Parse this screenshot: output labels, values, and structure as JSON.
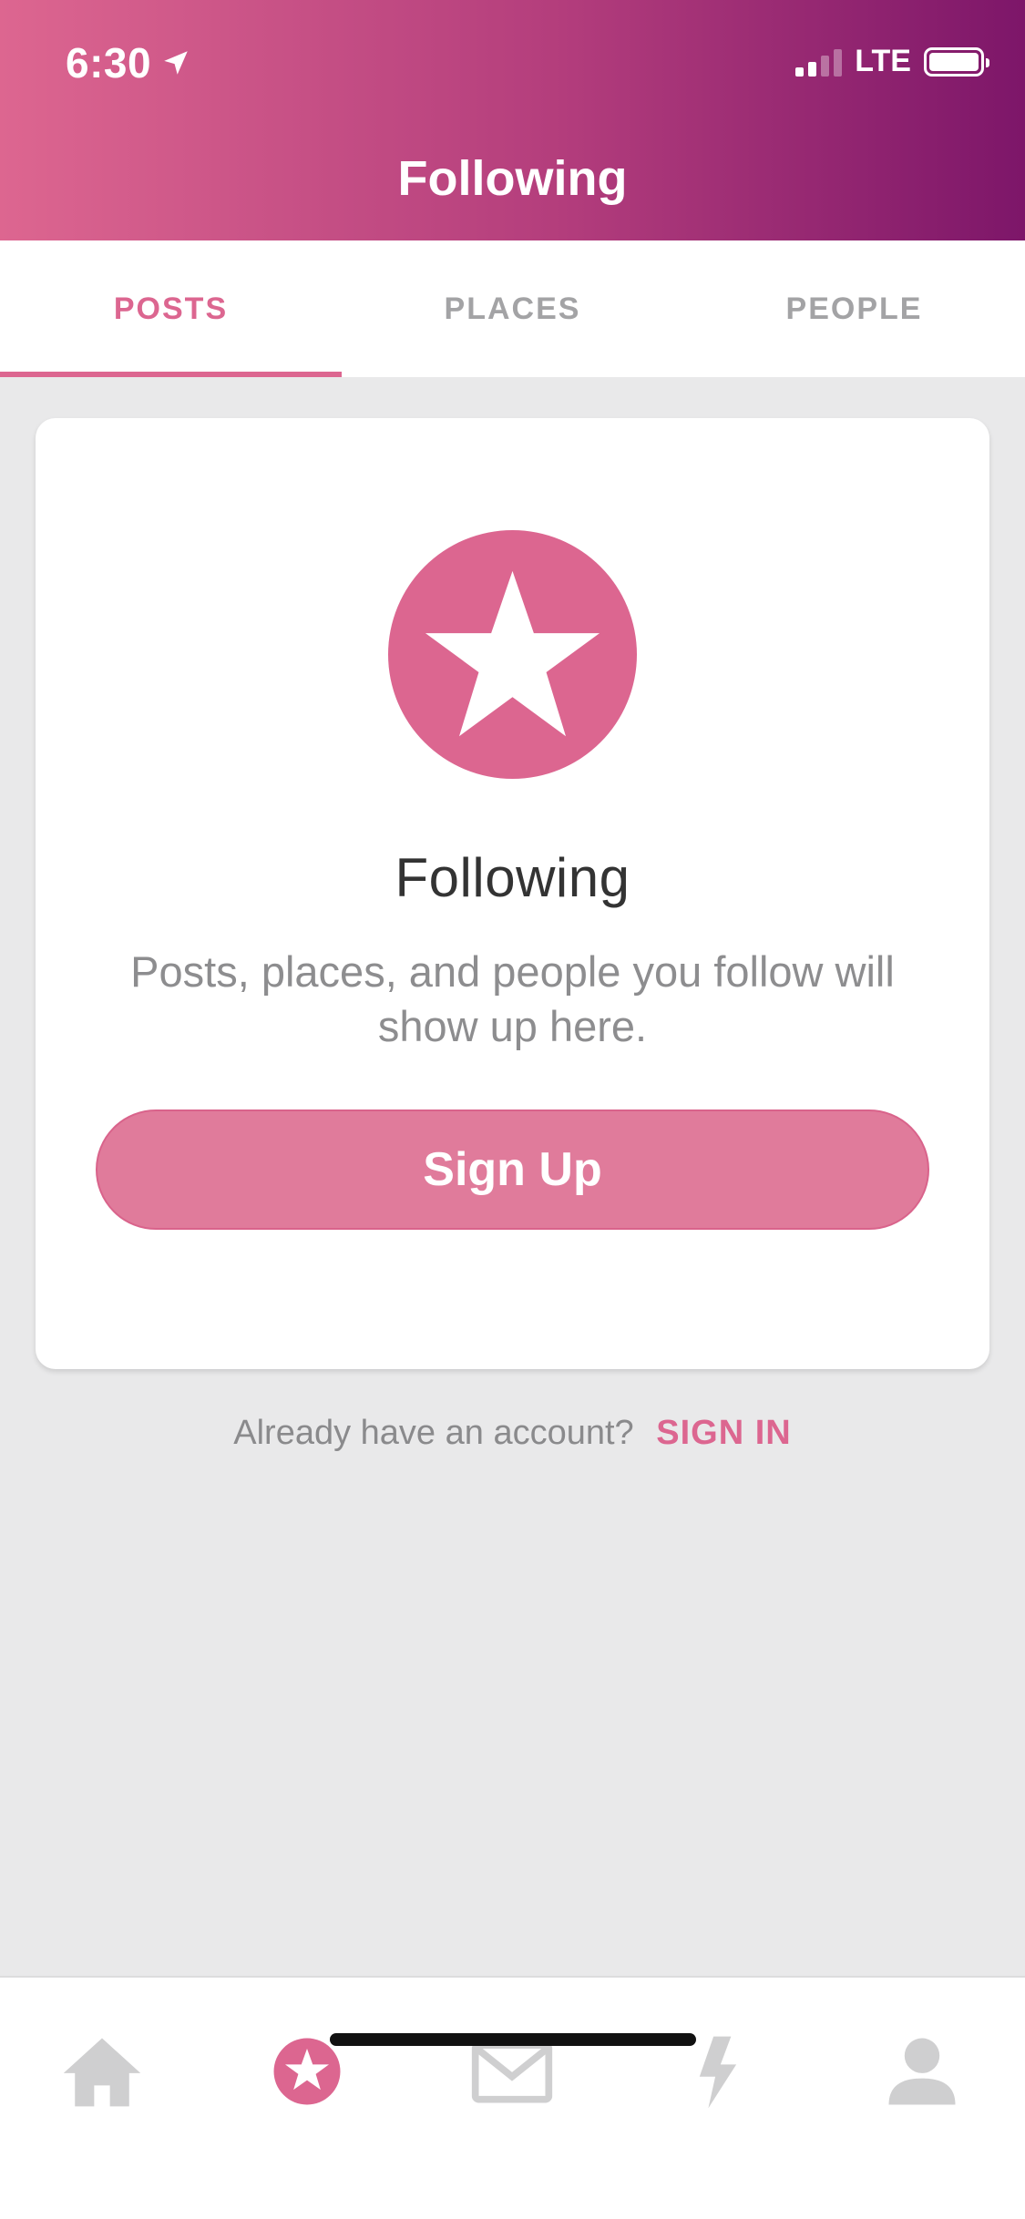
{
  "status_bar": {
    "time": "6:30",
    "network": "LTE",
    "location_icon": "location-arrow-icon",
    "signal_icon": "signal-icon",
    "battery_icon": "battery-icon"
  },
  "header": {
    "title": "Following",
    "gradient_start": "#dd6690",
    "gradient_end": "#7d1669"
  },
  "tabs": [
    {
      "label": "POSTS",
      "active": true
    },
    {
      "label": "PLACES",
      "active": false
    },
    {
      "label": "PEOPLE",
      "active": false
    }
  ],
  "card": {
    "icon": "star-icon",
    "title": "Following",
    "text": "Posts, places, and people you follow will show up here.",
    "button_label": "Sign Up"
  },
  "signin": {
    "prompt": "Already have an account?",
    "link_label": "SIGN IN"
  },
  "bottom_nav": [
    {
      "icon": "home-icon",
      "active": false
    },
    {
      "icon": "star-icon",
      "active": true
    },
    {
      "icon": "mail-icon",
      "active": false
    },
    {
      "icon": "lightning-icon",
      "active": false
    },
    {
      "icon": "profile-icon",
      "active": false
    }
  ],
  "colors": {
    "accent": "#dc6690",
    "button": "#e07b9b",
    "inactive": "#a3a3a5",
    "background": "#e9e9ea"
  }
}
